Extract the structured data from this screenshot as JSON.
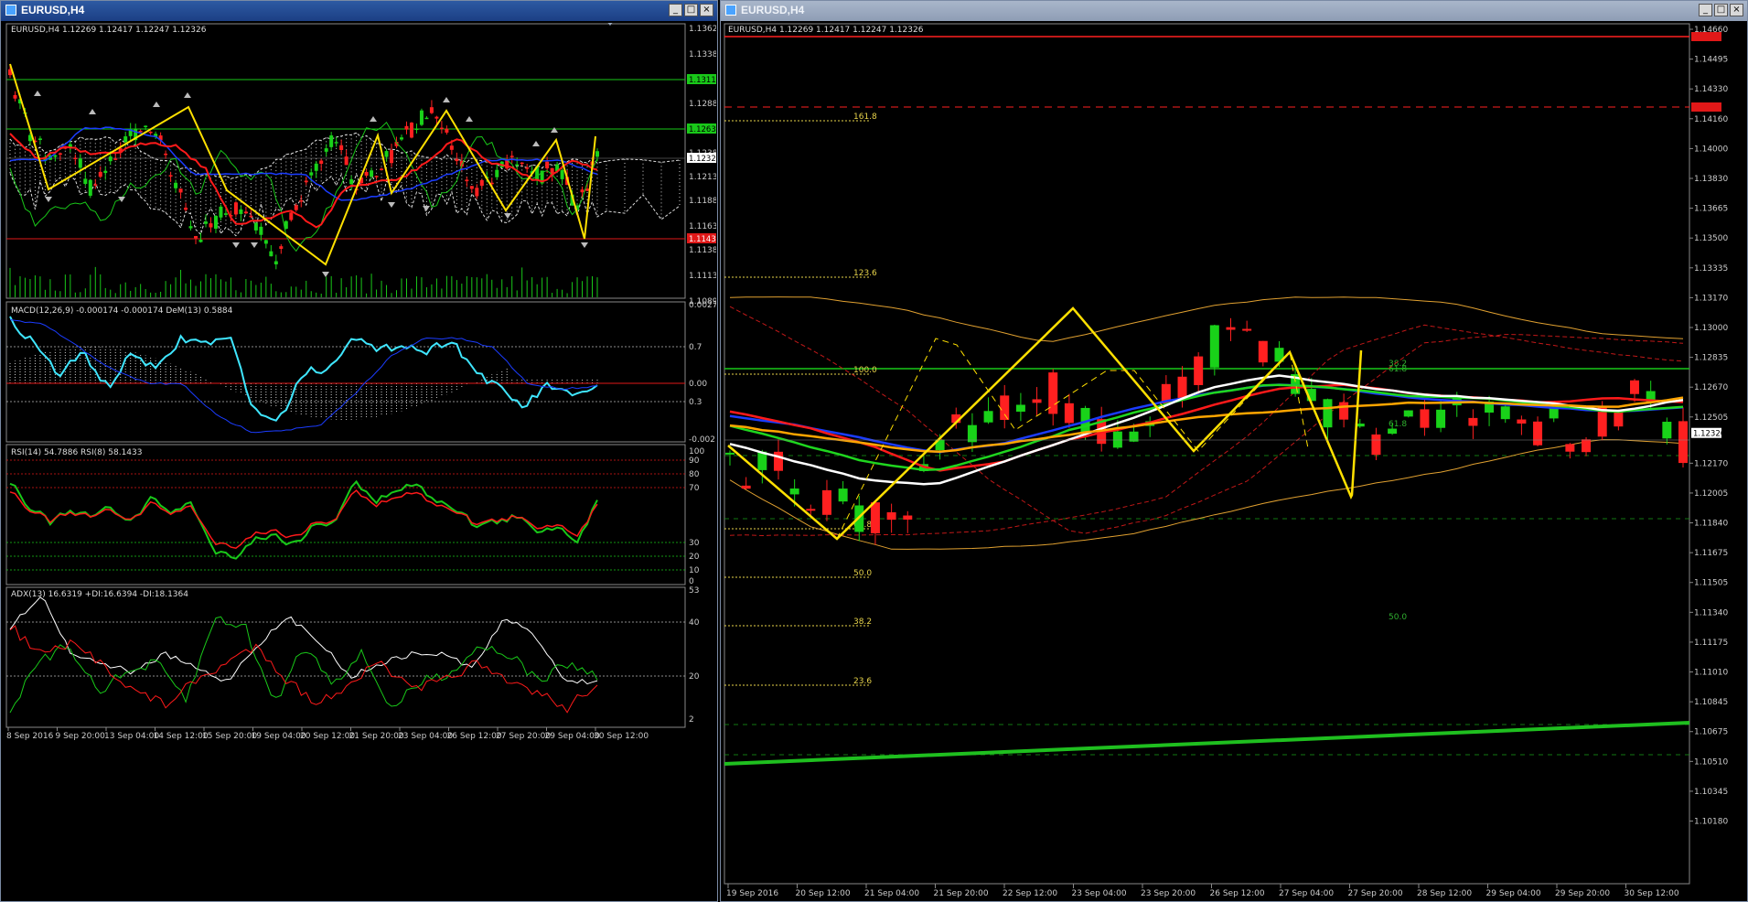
{
  "left_window": {
    "title": "EURUSD,H4",
    "controls": [
      "_",
      "□",
      "×"
    ],
    "main": {
      "header": "EURUSD,H4  1.12269 1.12417 1.12247 1.12326",
      "price_ticks": [
        "1.13625",
        "1.13380",
        "1.13114",
        "1.12880",
        "1.12634",
        "1.12380",
        "1.12326",
        "1.12135",
        "1.11885",
        "1.11635",
        "1.11434",
        "1.11385",
        "1.11135",
        "1.10890"
      ],
      "resistance_1": "1.13114",
      "resistance_2": "1.12634",
      "current_price": "1.12326",
      "support": "1.11434"
    },
    "macd": {
      "header": "MACD(12,26,9) -0.000174 -0.000174  DeM(13) 0.5884",
      "ticks": [
        "0.002763",
        "0.7",
        "0.00",
        "0.3",
        "-0.002105"
      ]
    },
    "rsi": {
      "header": "RSI(14) 54.7886  RSI(8) 58.1433",
      "ticks": [
        "100",
        "90",
        "80",
        "70",
        "30",
        "20",
        "10",
        "0"
      ]
    },
    "adx": {
      "header": "ADX(13) 16.6319 +DI:16.6394 -DI:18.1364",
      "ticks": [
        "53",
        "40",
        "20",
        "2"
      ]
    },
    "time_axis": [
      "8 Sep 2016",
      "9 Sep 20:00",
      "13 Sep 04:00",
      "14 Sep 12:00",
      "15 Sep 20:00",
      "19 Sep 04:00",
      "20 Sep 12:00",
      "21 Sep 20:00",
      "23 Sep 04:00",
      "26 Sep 12:00",
      "27 Sep 20:00",
      "29 Sep 04:00",
      "30 Sep 12:00"
    ]
  },
  "right_window": {
    "title": "EURUSD,H4",
    "controls": [
      "_",
      "□",
      "×"
    ],
    "main": {
      "header": "EURUSD,H4  1.12269 1.12417 1.12247 1.12326",
      "price_ticks": [
        "1.14660",
        "1.14495",
        "1.14330",
        "1.14160",
        "1.14000",
        "1.13830",
        "1.13665",
        "1.13500",
        "1.13335",
        "1.13170",
        "1.13000",
        "1.12835",
        "1.12670",
        "1.12505",
        "1.12326",
        "1.12170",
        "1.12005",
        "1.11840",
        "1.11675",
        "1.11505",
        "1.11340",
        "1.11175",
        "1.11010",
        "1.10845",
        "1.10675",
        "1.10510",
        "1.10345",
        "1.10180"
      ],
      "current_price": "1.12326",
      "fib_levels": [
        "161.8",
        "123.6",
        "100.0",
        "61.8",
        "50.0",
        "38.2",
        "23.6"
      ],
      "right_fib_labels": [
        "38.2",
        "61.8",
        "61.8",
        "50.0"
      ]
    },
    "time_axis": [
      "19 Sep 2016",
      "20 Sep 12:00",
      "21 Sep 04:00",
      "21 Sep 20:00",
      "22 Sep 12:00",
      "23 Sep 04:00",
      "23 Sep 20:00",
      "26 Sep 12:00",
      "27 Sep 04:00",
      "27 Sep 20:00",
      "28 Sep 12:00",
      "29 Sep 04:00",
      "29 Sep 20:00",
      "30 Sep 12:00"
    ]
  },
  "colors": {
    "bull": "#19d219",
    "bear": "#ff2020",
    "zigzag": "#ffe000",
    "ma_blue": "#1b3cff",
    "ma_red": "#ff1a1a",
    "ma_white": "#ffffff",
    "ma_green": "#1fd61f",
    "ma_orange": "#ffa500",
    "macd_cyan": "#3fe6ff",
    "grid": "#777"
  }
}
